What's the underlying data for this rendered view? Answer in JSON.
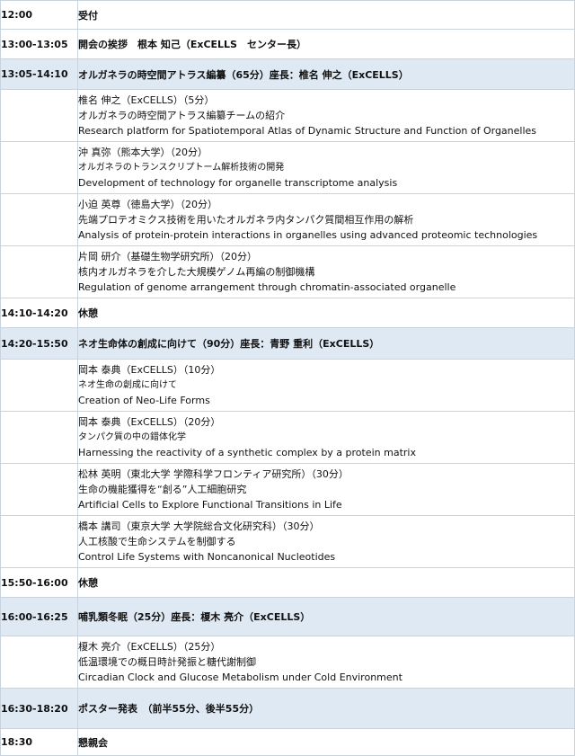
{
  "rows": [
    {
      "time": "12:00",
      "title": "受付"
    },
    {
      "time": "13:00-13:05",
      "title": "開会の挨拶　根本 知己（ExCELLS　センター長）"
    },
    {
      "time": "13:05-14:10",
      "title": "オルガネラの時空間アトラス編纂（65分）座長：椎名 伸之（ExCELLS）"
    },
    {
      "speaker": "椎名 伸之（ExCELLS）（5分）",
      "title_jp": "オルガネラの時空間アトラス編纂チームの紹介",
      "title_en": "Research platform for Spatiotemporal Atlas of Dynamic Structure and Function of Organelles"
    },
    {
      "speaker": "沖 真弥（熊本大学）（20分）",
      "title_jp": "オルガネラのトランスクリプトーム解析技術の開発",
      "title_en": "Development of technology for organelle transcriptome analysis"
    },
    {
      "speaker": "小迫 英尊（徳島大学）（20分）",
      "title_jp": "先端プロテオミクス技術を用いたオルガネラ内タンパク質間相互作用の解析",
      "title_en": "Analysis of protein-protein interactions in organelles using advanced proteomic technologies"
    },
    {
      "speaker": "片岡 研介（基礎生物学研究所）（20分）",
      "title_jp": "核内オルガネラを介した大規模ゲノム再編の制御機構",
      "title_en": "Regulation of genome arrangement through chromatin-associated organelle"
    },
    {
      "time": "14:10-14:20",
      "title": "休憩"
    },
    {
      "time": "14:20-15:50",
      "title": "ネオ生命体の創成に向けて（90分）座長：青野 重利（ExCELLS）"
    },
    {
      "speaker": "岡本 泰典（ExCELLS）（10分）",
      "title_jp": "ネオ生命の創成に向けて",
      "title_en": "Creation of Neo-Life Forms"
    },
    {
      "speaker": "岡本 泰典（ExCELLS）（20分）",
      "title_jp": "タンパク質の中の錯体化学",
      "title_en": "Harnessing the reactivity of a synthetic complex by a protein matrix"
    },
    {
      "speaker": "松林 英明（東北大学 学際科学フロンティア研究所）（30分）",
      "title_jp": "生命の機能獲得を“創る”人工細胞研究",
      "title_en": "Artificial Cells to Explore Functional Transitions in Life"
    },
    {
      "speaker": "橋本 講司（東京大学 大学院総合文化研究科）（30分）",
      "title_jp": "人工核酸で生命システムを制御する",
      "title_en": "Control Life Systems with Noncanonical Nucleotides"
    },
    {
      "time": "15:50-16:00",
      "title": "休憩"
    },
    {
      "time": "16:00-16:25",
      "title": "哺乳類冬眠（25分）座長：榎木 亮介（ExCELLS）"
    },
    {
      "speaker": "榎木 亮介（ExCELLS）（25分）",
      "title_jp": "低温環境での概日時計発振と糖代謝制御",
      "title_en": "Circadian Clock and Glucose Metabolism under Cold Environment"
    },
    {
      "time": "16:30-18:20",
      "title": "ポスター発表　（前半55分、後半55分）"
    },
    {
      "time": "18:30",
      "title": "懇親会"
    }
  ]
}
